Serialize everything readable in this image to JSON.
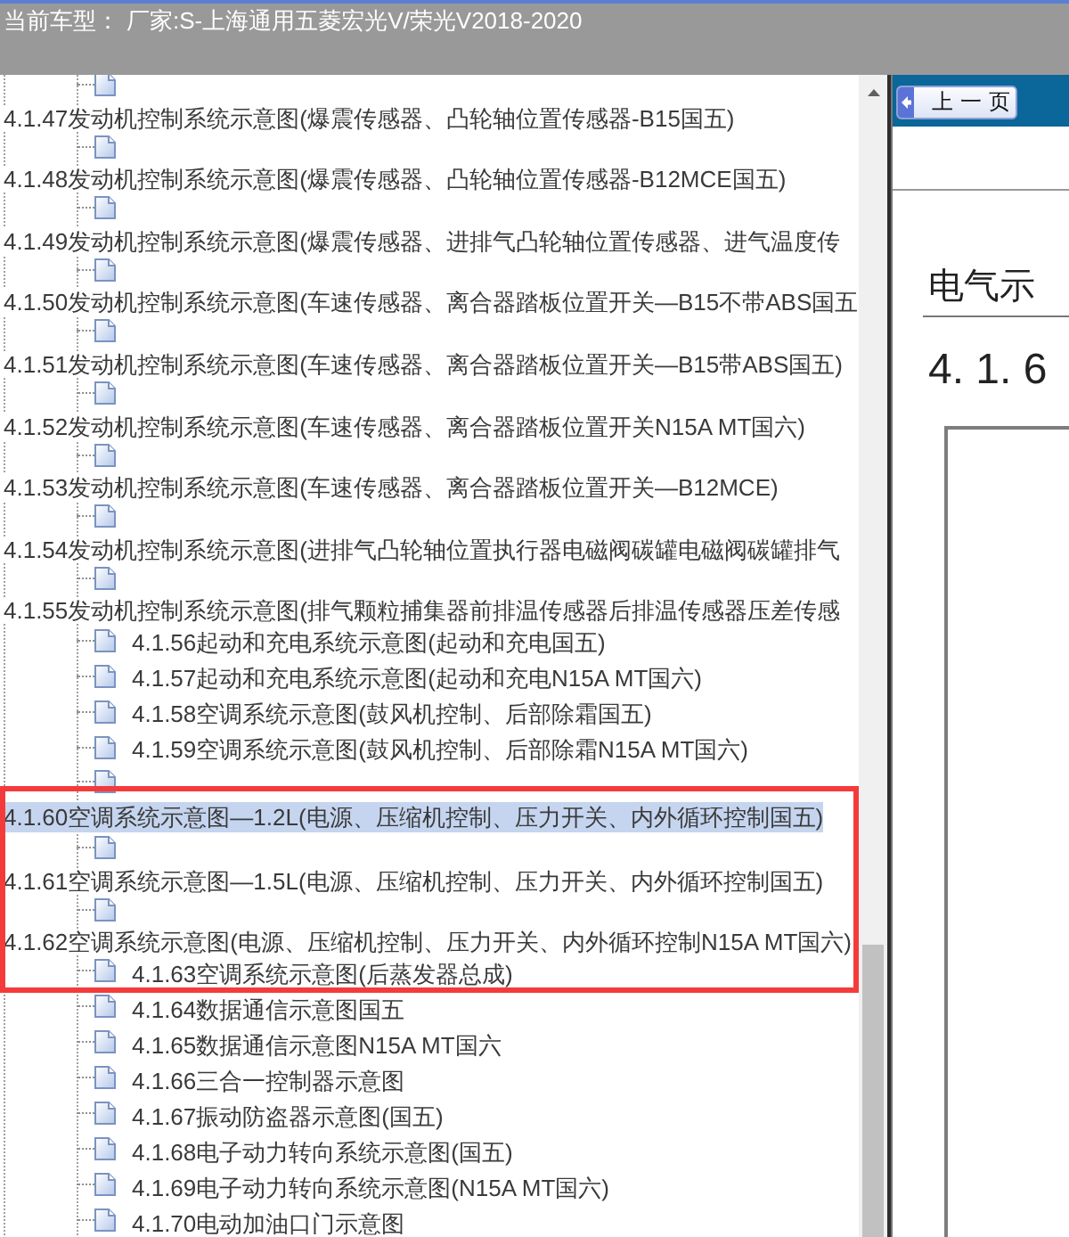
{
  "header": {
    "label": "当前车型：",
    "value": "厂家:S-上海通用五菱宏光V/荣光V2018-2020"
  },
  "tree": {
    "items": [
      {
        "label": "4.1.47发动机控制系统示意图(爆震传感器、凸轮轴位置传感器-B15国五)",
        "selected": false,
        "annotated": false
      },
      {
        "label": "4.1.48发动机控制系统示意图(爆震传感器、凸轮轴位置传感器-B12MCE国五)",
        "selected": false,
        "annotated": false
      },
      {
        "label": "4.1.49发动机控制系统示意图(爆震传感器、进排气凸轮轴位置传感器、进气温度传",
        "selected": false,
        "annotated": false
      },
      {
        "label": "4.1.50发动机控制系统示意图(车速传感器、离合器踏板位置开关—B15不带ABS国五",
        "selected": false,
        "annotated": false
      },
      {
        "label": "4.1.51发动机控制系统示意图(车速传感器、离合器踏板位置开关—B15带ABS国五)",
        "selected": false,
        "annotated": false
      },
      {
        "label": "4.1.52发动机控制系统示意图(车速传感器、离合器踏板位置开关N15A MT国六)",
        "selected": false,
        "annotated": false
      },
      {
        "label": "4.1.53发动机控制系统示意图(车速传感器、离合器踏板位置开关—B12MCE)",
        "selected": false,
        "annotated": false
      },
      {
        "label": "4.1.54发动机控制系统示意图(进排气凸轮轴位置执行器电磁阀碳罐电磁阀碳罐排气",
        "selected": false,
        "annotated": false
      },
      {
        "label": "4.1.55发动机控制系统示意图(排气颗粒捕集器前排温传感器后排温传感器压差传感",
        "selected": false,
        "annotated": false
      },
      {
        "label": "4.1.56起动和充电系统示意图(起动和充电国五)",
        "selected": false,
        "annotated": false
      },
      {
        "label": "4.1.57起动和充电系统示意图(起动和充电N15A MT国六)",
        "selected": false,
        "annotated": false
      },
      {
        "label": "4.1.58空调系统示意图(鼓风机控制、后部除霜国五)",
        "selected": false,
        "annotated": false
      },
      {
        "label": "4.1.59空调系统示意图(鼓风机控制、后部除霜N15A MT国六)",
        "selected": false,
        "annotated": false
      },
      {
        "label": "4.1.60空调系统示意图—1.2L(电源、压缩机控制、压力开关、内外循环控制国五)",
        "selected": true,
        "annotated": true
      },
      {
        "label": "4.1.61空调系统示意图—1.5L(电源、压缩机控制、压力开关、内外循环控制国五)",
        "selected": false,
        "annotated": true
      },
      {
        "label": "4.1.62空调系统示意图(电源、压缩机控制、压力开关、内外循环控制N15A MT国六)",
        "selected": false,
        "annotated": true
      },
      {
        "label": "4.1.63空调系统示意图(后蒸发器总成)",
        "selected": false,
        "annotated": true
      },
      {
        "label": "4.1.64数据通信示意图国五",
        "selected": false,
        "annotated": false
      },
      {
        "label": "4.1.65数据通信示意图N15A MT国六",
        "selected": false,
        "annotated": false
      },
      {
        "label": "4.1.66三合一控制器示意图",
        "selected": false,
        "annotated": false
      },
      {
        "label": "4.1.67振动防盗器示意图(国五)",
        "selected": false,
        "annotated": false
      },
      {
        "label": "4.1.68电子动力转向系统示意图(国五)",
        "selected": false,
        "annotated": false
      },
      {
        "label": "4.1.69电子动力转向系统示意图(N15A MT国六)",
        "selected": false,
        "annotated": false
      },
      {
        "label": "4.1.70电动加油口门示意图",
        "selected": false,
        "annotated": false
      }
    ]
  },
  "viewer": {
    "prev_button": "上一页",
    "heading": "电气示",
    "section_number": "4. 1. 6"
  }
}
